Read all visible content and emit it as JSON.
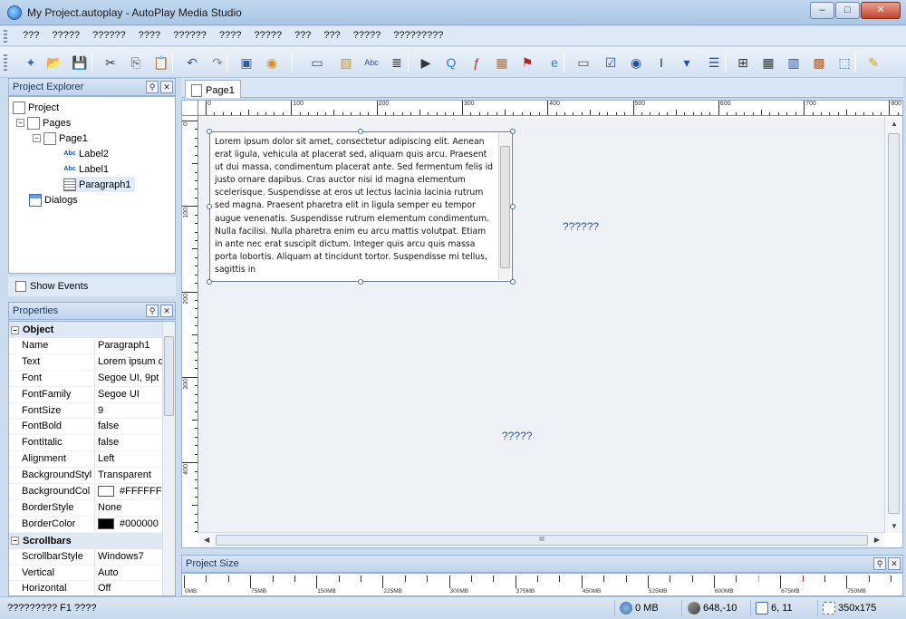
{
  "window": {
    "title": "My Project.autoplay - AutoPlay Media Studio",
    "minimize_label": "–",
    "maximize_label": "□",
    "close_label": "✕"
  },
  "menubar": {
    "items": [
      "???",
      "?????",
      "??????",
      "????",
      "??????",
      "????",
      "?????",
      "???",
      "???",
      "?????",
      "?????????"
    ]
  },
  "toolbar": {
    "icons": [
      "wand-icon",
      "open-folder-icon",
      "save-icon",
      "cut-icon",
      "copy-icon",
      "paste-icon",
      "undo-icon",
      "redo-icon",
      "preview-icon",
      "build-cd-icon",
      "button-object-icon",
      "image-object-icon",
      "label-object-icon",
      "paragraph-object-icon",
      "video-object-icon",
      "quicktime-object-icon",
      "flash-object-icon",
      "slideshow-object-icon",
      "pdf-object-icon",
      "web-object-icon",
      "input-object-icon",
      "checkbox-object-icon",
      "radio-object-icon",
      "textbox-object-icon",
      "combobox-object-icon",
      "listbox-object-icon",
      "tree-object-icon",
      "grid-object-icon",
      "columns-object-icon",
      "plugin-object-icon",
      "selection-icon",
      "pencil-icon"
    ]
  },
  "explorer": {
    "title": "Project Explorer",
    "tree": [
      {
        "label": "Project",
        "icon": "project-icon"
      },
      {
        "label": "Pages",
        "icon": "pages-icon"
      },
      {
        "label": "Page1",
        "icon": "page-icon"
      },
      {
        "label": "Label2",
        "icon": "label-icon"
      },
      {
        "label": "Label1",
        "icon": "label-icon"
      },
      {
        "label": "Paragraph1",
        "icon": "paragraph-icon"
      },
      {
        "label": "Dialogs",
        "icon": "dialogs-icon"
      }
    ],
    "show_events_label": "Show Events"
  },
  "properties": {
    "title": "Properties",
    "categories": [
      {
        "name": "Object",
        "rows": [
          {
            "name": "Name",
            "value": "Paragraph1"
          },
          {
            "name": "Text",
            "value": "Lorem ipsum d"
          },
          {
            "name": "Font",
            "value": "Segoe UI, 9pt"
          },
          {
            "name": "FontFamily",
            "value": "Segoe UI"
          },
          {
            "name": "FontSize",
            "value": "9"
          },
          {
            "name": "FontBold",
            "value": "false"
          },
          {
            "name": "FontItalic",
            "value": "false"
          },
          {
            "name": "Alignment",
            "value": "Left"
          },
          {
            "name": "BackgroundStyl",
            "value": "Transparent"
          },
          {
            "name": "BackgroundCol",
            "value": "#FFFFFF",
            "swatch": "#FFFFFF"
          },
          {
            "name": "BorderStyle",
            "value": "None"
          },
          {
            "name": "BorderColor",
            "value": "#000000",
            "swatch": "#000000"
          }
        ]
      },
      {
        "name": "Scrollbars",
        "rows": [
          {
            "name": "ScrollbarStyle",
            "value": "Windows7"
          },
          {
            "name": "Vertical",
            "value": "Auto"
          },
          {
            "name": "Horizontal",
            "value": "Off"
          }
        ]
      }
    ]
  },
  "editor": {
    "tab_label": "Page1",
    "ruler_h": [
      "0",
      "100",
      "200",
      "300",
      "400",
      "500",
      "600",
      "700",
      "800"
    ],
    "ruler_v": [
      "0",
      "100",
      "200",
      "300",
      "400"
    ],
    "paragraph_text": "Lorem ipsum dolor sit amet, consectetur adipiscing elit. Aenean erat ligula, vehicula at placerat sed, aliquam quis arcu. Praesent ut dui massa, condimentum placerat ante. Sed fermentum felis id justo ornare dapibus. Cras auctor nisi id magna elementum scelerisque. Suspendisse at eros ut lectus lacinia lacinia rutrum sed magna. Praesent pharetra elit in ligula semper eu tempor augue venenatis. Suspendisse rutrum elementum condimentum. Nulla facilisi. Nulla pharetra enim eu arcu mattis volutpat. Etiam in ante nec erat suscipit dictum. Integer quis arcu quis massa porta lobortis. Aliquam at tincidunt tortor. Suspendisse mi tellus, sagittis in",
    "label1_text": "??????",
    "label2_text": "?????",
    "hscroll_grip": "III"
  },
  "project_size": {
    "title": "Project Size",
    "marks": [
      "0MB",
      "75MB",
      "150MB",
      "225MB",
      "300MB",
      "375MB",
      "450MB",
      "525MB",
      "600MB",
      "675MB",
      "750MB"
    ]
  },
  "statusbar": {
    "help_text": "????????? F1 ????",
    "size": "0 MB",
    "cursor_pos": "648,-10",
    "grid": "6, 11",
    "object_size": "350x175"
  },
  "colors": {
    "accent": "#2a57a8",
    "panel_border": "#98b1d0"
  }
}
